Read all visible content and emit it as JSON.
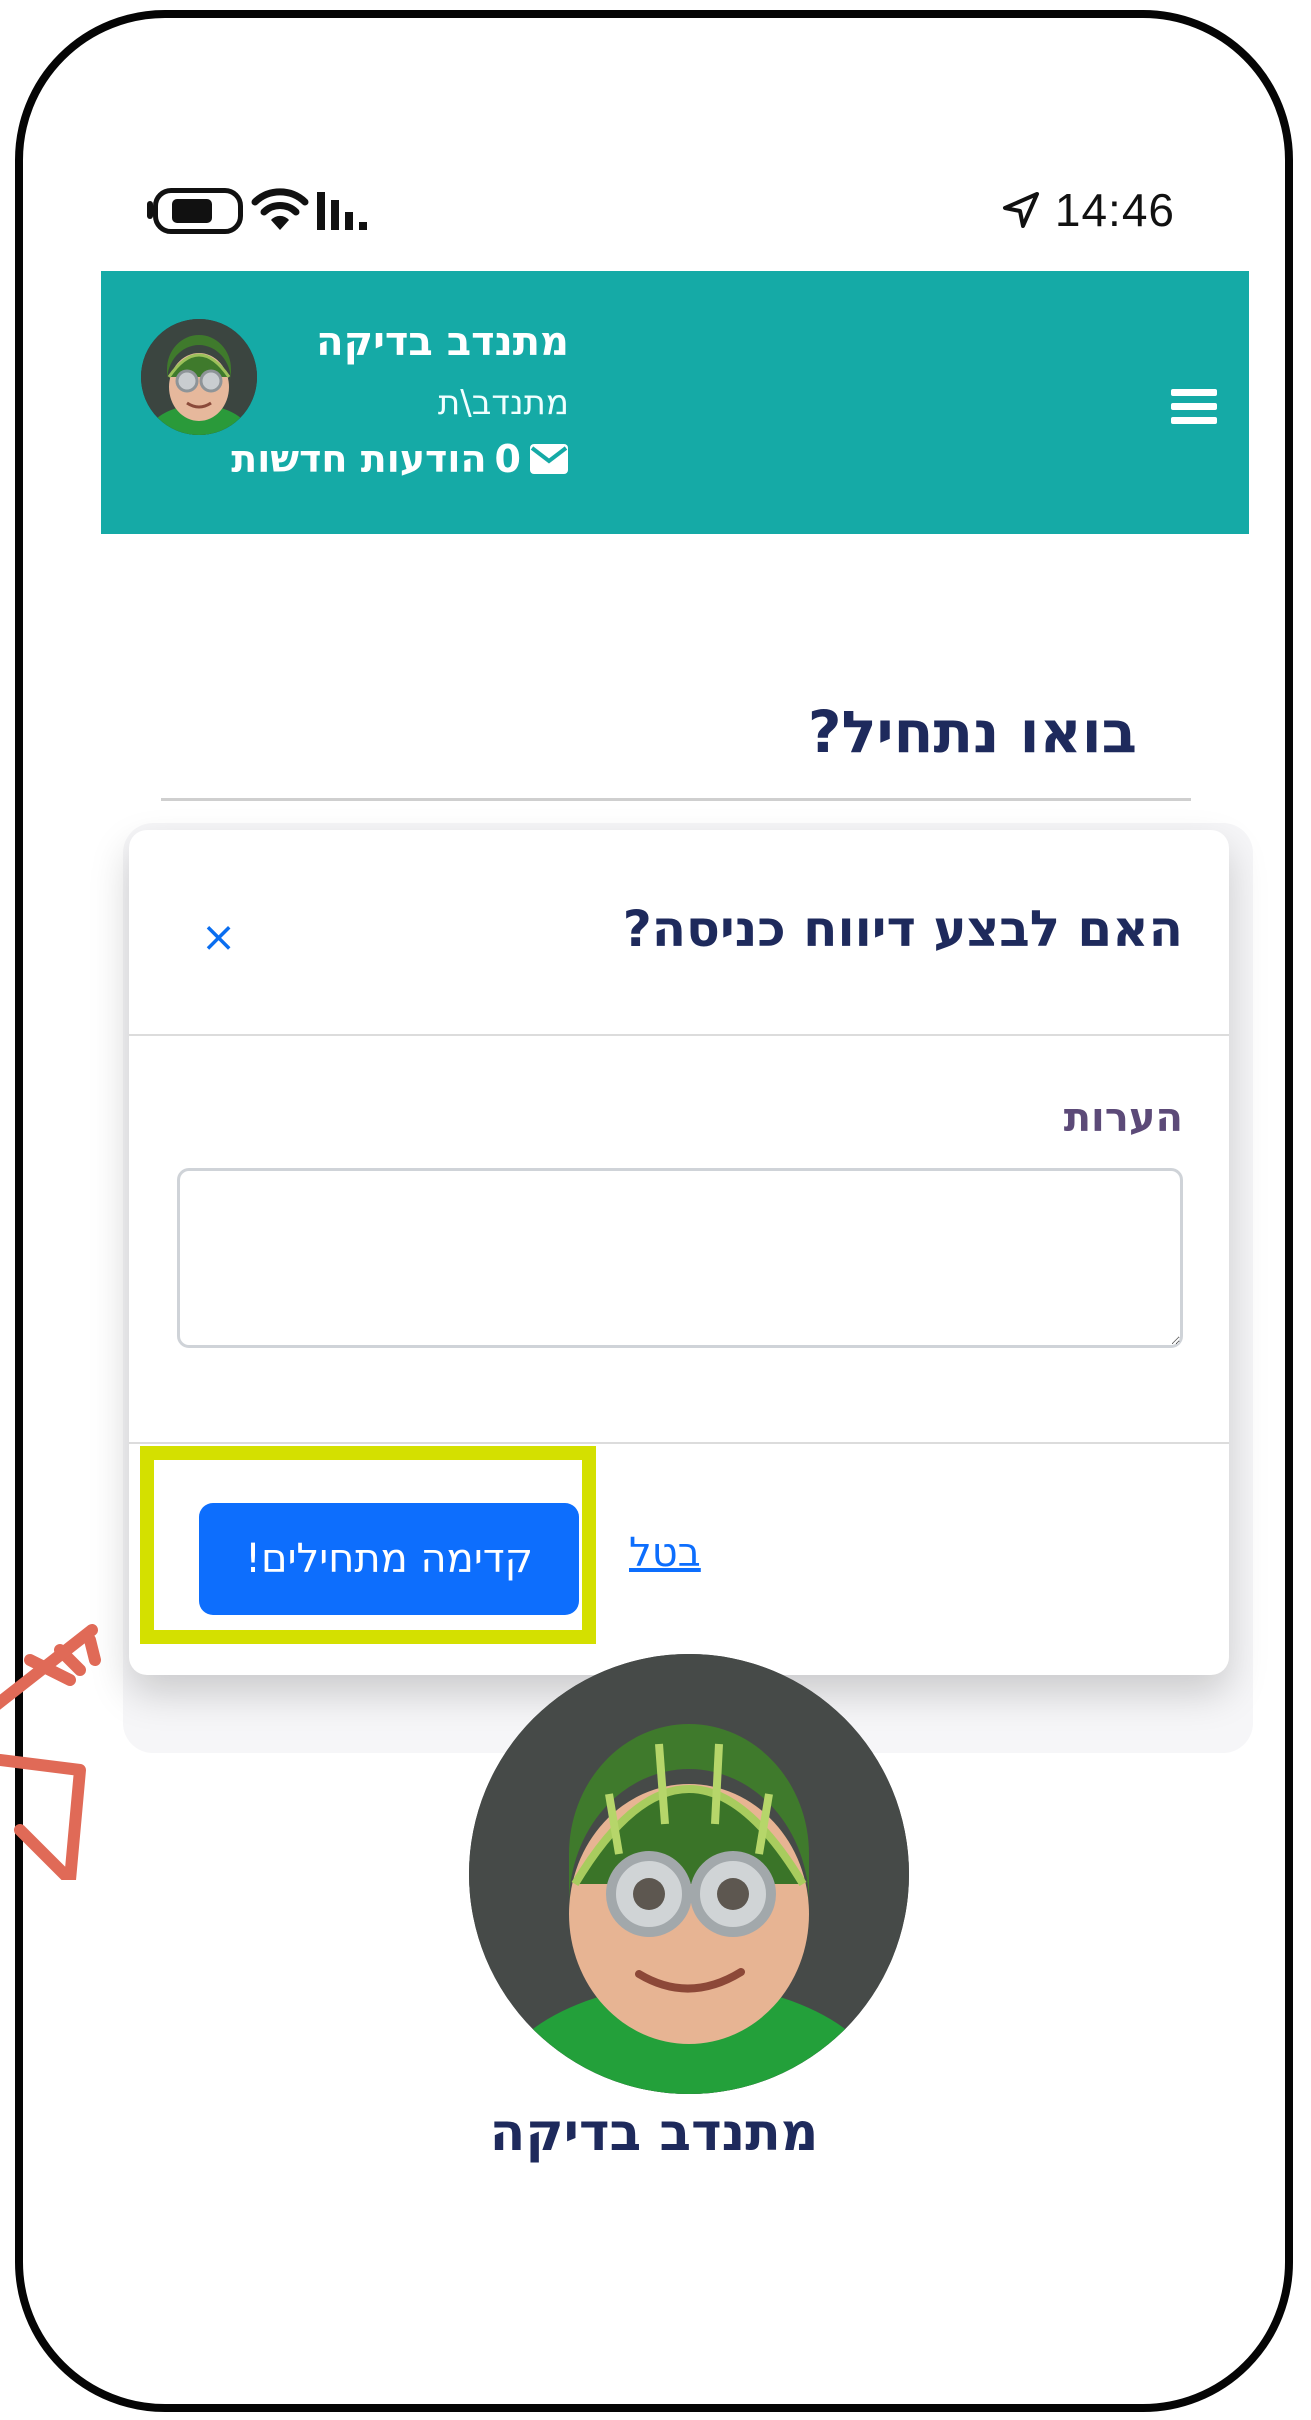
{
  "status_bar": {
    "time": "14:46",
    "icons": [
      "battery-icon",
      "wifi-icon",
      "signal-icon",
      "location-arrow-icon"
    ]
  },
  "header": {
    "user_name": "מתנדב בדיקה",
    "user_role": "מתנדב\\ת",
    "messages_count": "0",
    "messages_label": "הודעות חדשות",
    "colors": {
      "background": "#15aaa6",
      "text": "#ffffff"
    }
  },
  "page": {
    "title": "בואו נתחיל?"
  },
  "modal": {
    "title": "האם לבצע דיווח כניסה?",
    "close_label": "×",
    "notes_label": "הערות",
    "notes_value": "",
    "primary_button": "קדימה מתחילים!",
    "cancel_link": "בטל",
    "colors": {
      "primary": "#0d6efd",
      "title": "#1e2a5c"
    }
  },
  "profile": {
    "name": "מתנדב בדיקה"
  },
  "annotation": {
    "highlight_color": "#d4e000",
    "arrow_color": "#e06a57"
  }
}
